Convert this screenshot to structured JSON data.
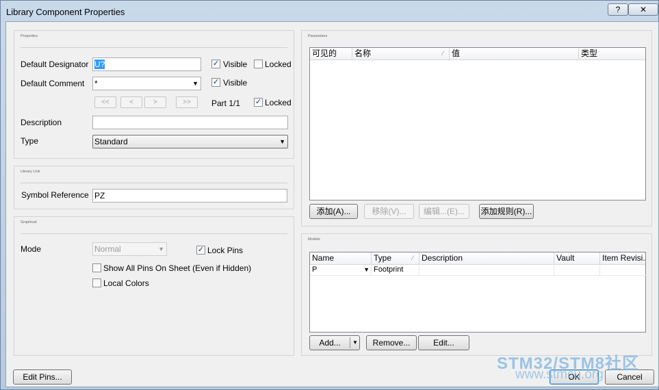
{
  "window": {
    "title": "Library Component Properties",
    "help_label": "?",
    "close_label": "✕"
  },
  "properties": {
    "group_title": "Properties",
    "designator_label": "Default Designator",
    "designator_value": "U?",
    "comment_label": "Default Comment",
    "comment_value": "*",
    "visible_label_1": "Visible",
    "visible_label_2": "Visible",
    "locked_label_1": "Locked",
    "locked_label_2": "Locked",
    "nav_first": "<<",
    "nav_prev": "<",
    "nav_next": ">",
    "nav_last": ">>",
    "part_label": "Part 1/1",
    "description_label": "Description",
    "description_value": "",
    "type_label": "Type",
    "type_value": "Standard"
  },
  "library_link": {
    "group_title": "Library Link",
    "symbol_label": "Symbol Reference",
    "symbol_value": "PZ"
  },
  "graphical": {
    "group_title": "Graphical",
    "mode_label": "Mode",
    "mode_value": "Normal",
    "lock_pins_label": "Lock Pins",
    "show_pins_label": "Show All Pins On Sheet (Even if Hidden)",
    "local_colors_label": "Local Colors"
  },
  "parameters": {
    "group_title": "Parameters",
    "columns": [
      "可见的",
      "名称",
      "值",
      "类型"
    ],
    "add_label": "添加(A)...",
    "remove_label": "移除(V)...",
    "edit_label": "编辑...(E)...",
    "add_rule_label": "添加规则(R)..."
  },
  "models": {
    "group_title": "Models",
    "columns": [
      "Name",
      "Type",
      "Description",
      "Vault",
      "Item Revisi..."
    ],
    "rows": [
      {
        "name": "P",
        "type": "Footprint",
        "description": "",
        "vault": "",
        "item_revision": ""
      }
    ],
    "add_label": "Add...",
    "remove_label": "Remove...",
    "edit_label": "Edit..."
  },
  "footer": {
    "edit_pins_label": "Edit Pins...",
    "ok_label": "OK",
    "cancel_label": "Cancel"
  },
  "watermark": {
    "line1": "STM32/STM8社区",
    "line2": "www.stmcu.org"
  }
}
